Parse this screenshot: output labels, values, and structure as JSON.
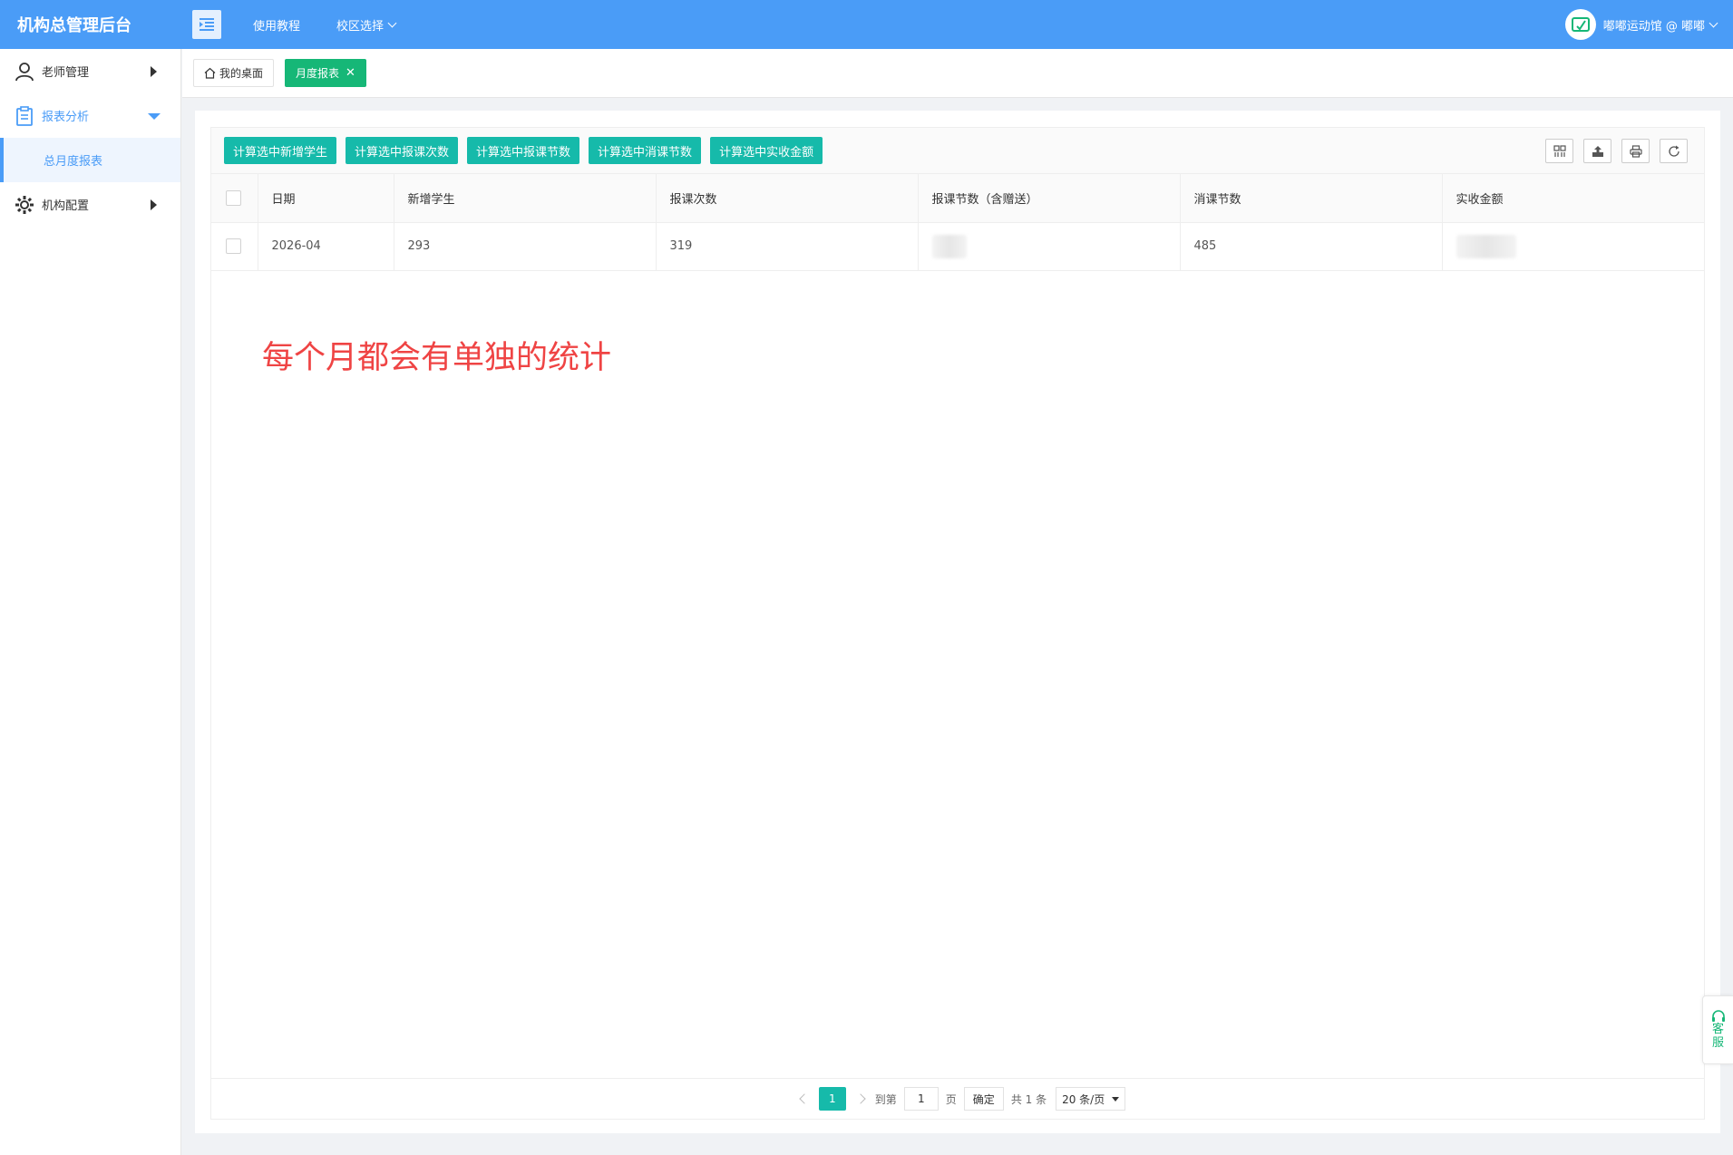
{
  "header": {
    "brand": "机构总管理后台",
    "nav": [
      {
        "label": "使用教程"
      },
      {
        "label": "校区选择"
      }
    ],
    "user": "嘟嘟运动馆 @ 嘟嘟"
  },
  "sidebar": {
    "items": [
      {
        "label": "老师管理"
      },
      {
        "label": "报表分析"
      },
      {
        "label": "总月度报表"
      },
      {
        "label": "机构配置"
      }
    ]
  },
  "tabs": [
    {
      "label": "我的桌面"
    },
    {
      "label": "月度报表"
    }
  ],
  "toolbar": {
    "buttons": [
      "计算选中新增学生",
      "计算选中报课次数",
      "计算选中报课节数",
      "计算选中消课节数",
      "计算选中实收金额"
    ]
  },
  "table": {
    "columns": [
      "日期",
      "新增学生",
      "报课次数",
      "报课节数（含赠送）",
      "消课节数",
      "实收金额"
    ],
    "rows": [
      {
        "date": "2026-04",
        "new_students": "293",
        "enroll_times": "319",
        "enroll_lessons": "",
        "consumed_lessons": "485",
        "amount": ""
      }
    ]
  },
  "annotation": "每个月都会有单独的统计",
  "pager": {
    "current": "1",
    "goto_label": "到第",
    "goto_value": "1",
    "page_unit": "页",
    "confirm": "确定",
    "total": "共 1 条",
    "page_size": "20 条/页"
  },
  "service": {
    "label": "客服"
  },
  "colors": {
    "primary": "#4a9cf7",
    "green": "#16b777",
    "teal": "#16baaa",
    "annotation": "#ef4444"
  }
}
